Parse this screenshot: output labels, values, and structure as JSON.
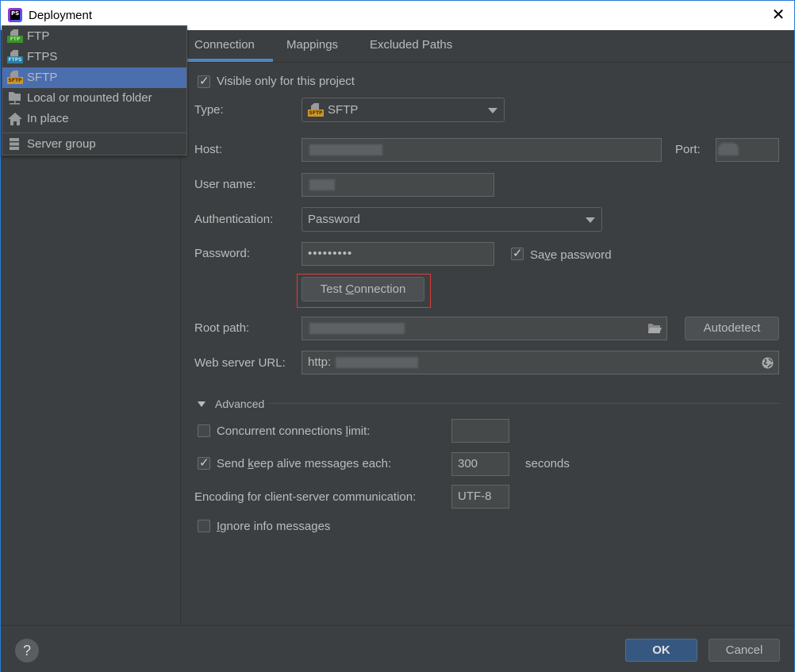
{
  "window": {
    "title": "Deployment",
    "close_glyph": "✕"
  },
  "toolbar": {
    "add": "+",
    "remove": "−",
    "apply": "✔"
  },
  "type_menu": {
    "items": [
      {
        "label": "FTP",
        "icon": "ftp-icon",
        "badge": "FTP",
        "badge_color": "#3f8f2f",
        "badge_text": "#a6f08a"
      },
      {
        "label": "FTPS",
        "icon": "ftps-icon",
        "badge": "FTPS",
        "badge_color": "#2d7ea0",
        "badge_text": "#a7e2ff"
      },
      {
        "label": "SFTP",
        "icon": "sftp-icon",
        "badge": "SFTP",
        "badge_color": "#c8962b",
        "badge_text": "#5a2a00",
        "selected": true
      },
      {
        "label": "Local or mounted folder",
        "icon": "folder-network-icon"
      },
      {
        "label": "In place",
        "icon": "home-icon"
      },
      {
        "label": "Server group",
        "icon": "server-group-icon"
      }
    ]
  },
  "tabs": [
    {
      "label": "Connection",
      "active": true
    },
    {
      "label": "Mappings"
    },
    {
      "label": "Excluded Paths"
    }
  ],
  "connection": {
    "visible_only_label": "Visible only for this project",
    "visible_only_checked": true,
    "type_label": "Type:",
    "type_value": "SFTP",
    "host_label": "Host:",
    "port_label": "Port:",
    "username_label": "User name:",
    "auth_label": "Authentication:",
    "auth_value": "Password",
    "password_label": "Password:",
    "password_value": "•••••••••",
    "save_password_pre": "Sa",
    "save_password_mn": "v",
    "save_password_post": "e password",
    "save_password_checked": true,
    "test_pre": "Test ",
    "test_mn": "C",
    "test_post": "onnection",
    "root_path_label": "Root path:",
    "autodetect_label": "Autodetect",
    "web_url_label": "Web server URL:",
    "web_url_value": "http:"
  },
  "advanced": {
    "header": "Advanced",
    "concurrent_pre": "Concurrent connections ",
    "concurrent_mn": "l",
    "concurrent_post": "imit:",
    "concurrent_checked": false,
    "concurrent_value": "",
    "keepalive_pre": "Send ",
    "keepalive_mn": "k",
    "keepalive_post": "eep alive messages each:",
    "keepalive_checked": true,
    "keepalive_value": "300",
    "keepalive_unit": "seconds",
    "encoding_label": "Encoding for client-server communication:",
    "encoding_value": "UTF-8",
    "ignore_pre": "",
    "ignore_mn": "I",
    "ignore_post": "gnore info messages",
    "ignore_checked": false
  },
  "footer": {
    "help": "?",
    "ok": "OK",
    "cancel": "Cancel"
  },
  "colors": {
    "accent": "#4a88c7",
    "selection": "#4b6eaf",
    "ok_button": "#365880",
    "highlight_box": "#e03a3a"
  }
}
